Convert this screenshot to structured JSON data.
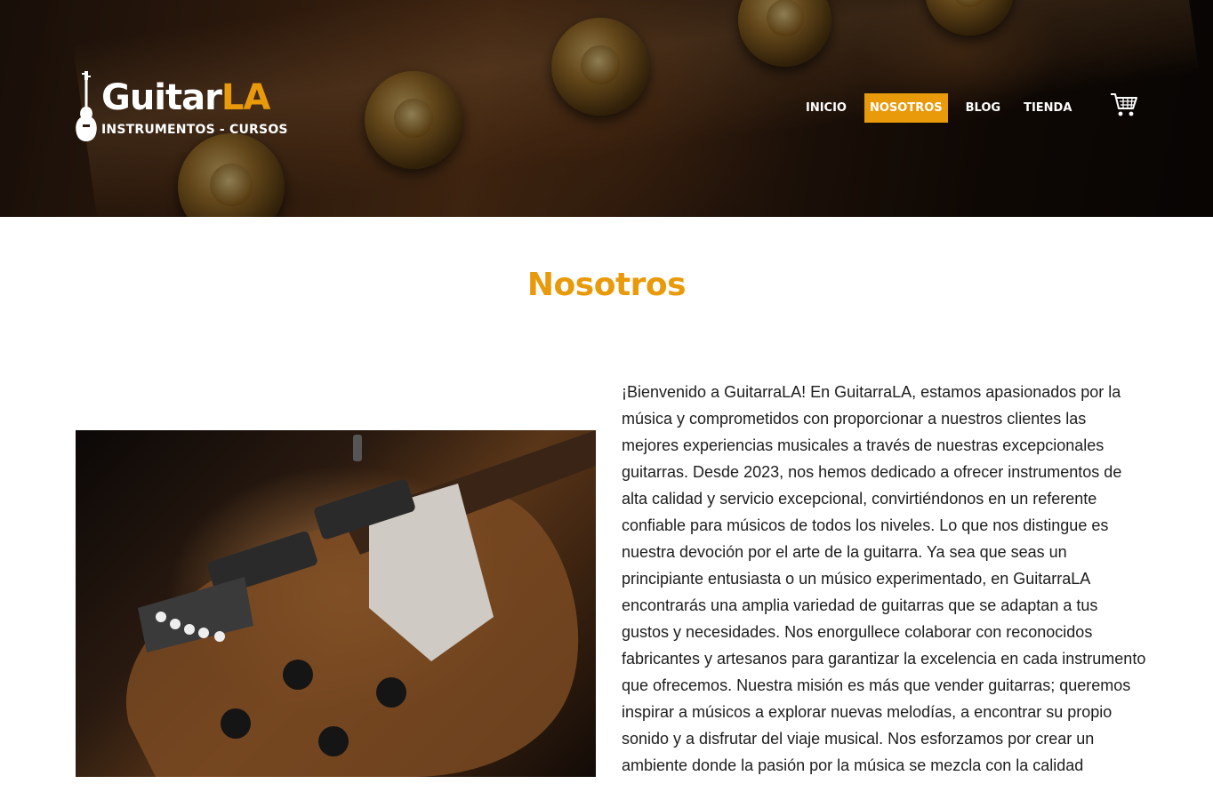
{
  "header": {
    "logo": {
      "brand_main": "Guitar",
      "brand_accent": "LA",
      "tagline": "INSTRUMENTOS - CURSOS",
      "icon": "guitar-icon"
    },
    "nav": [
      {
        "label": "INICIO",
        "active": false
      },
      {
        "label": "NOSOTROS",
        "active": true
      },
      {
        "label": "BLOG",
        "active": false
      },
      {
        "label": "TIENDA",
        "active": false
      }
    ],
    "cart_icon": "shopping-cart-icon"
  },
  "main": {
    "title": "Nosotros",
    "paragraph": "¡Bienvenido a GuitarraLA! En GuitarraLA, estamos apasionados por la música y comprometidos con proporcionar a nuestros clientes las mejores experiencias musicales a través de nuestras excepcionales guitarras. Desde 2023, nos hemos dedicado a ofrecer instrumentos de alta calidad y servicio excepcional, convirtiéndonos en un referente confiable para músicos de todos los niveles. Lo que nos distingue es nuestra devoción por el arte de la guitarra. Ya sea que seas un principiante entusiasta o un músico experimentado, en GuitarraLA encontrarás una amplia variedad de guitarras que se adaptan a tus gustos y necesidades. Nos enorgullece colaborar con reconocidos fabricantes y artesanos para garantizar la excelencia en cada instrumento que ofrecemos. Nuestra misión es más que vender guitarras; queremos inspirar a músicos a explorar nuevas melodías, a encontrar su propio sonido y a disfrutar del viaje musical. Nos esforzamos por crear un ambiente donde la pasión por la música se mezcla con la calidad"
  },
  "colors": {
    "accent": "#e99a0a",
    "text": "#1d1d1d",
    "nav_text": "#ffffff"
  }
}
